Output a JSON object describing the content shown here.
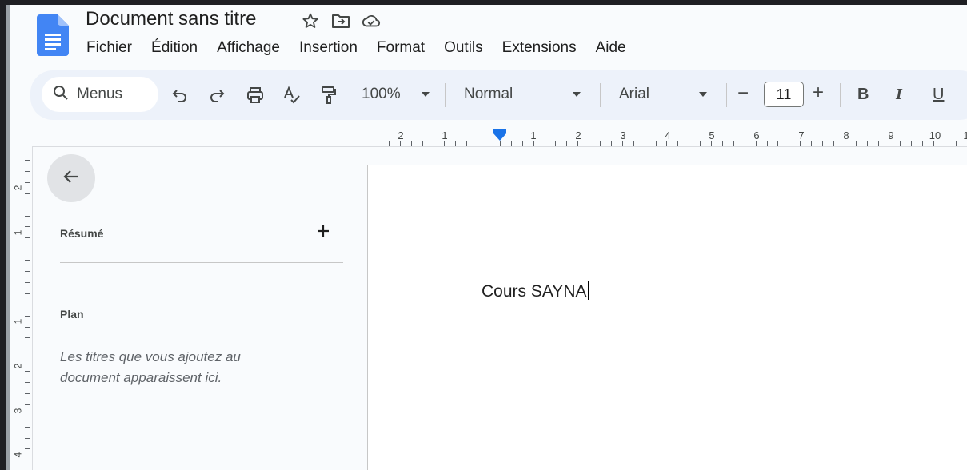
{
  "document": {
    "title": "Document sans titre"
  },
  "menu": [
    "Fichier",
    "Édition",
    "Affichage",
    "Insertion",
    "Format",
    "Outils",
    "Extensions",
    "Aide"
  ],
  "toolbar": {
    "search_label": "Menus",
    "zoom": "100%",
    "style": "Normal",
    "font": "Arial",
    "font_size": "11",
    "bold_label": "B",
    "italic_label": "I",
    "underline_label": "U",
    "decrease_label": "−",
    "increase_label": "+"
  },
  "ruler": {
    "h_numbers": [
      "2",
      "1",
      "1",
      "2",
      "3",
      "4",
      "5",
      "6",
      "7",
      "8",
      "9",
      "10",
      "1"
    ],
    "v_numbers": [
      "2",
      "1",
      "1",
      "2",
      "3",
      "4"
    ]
  },
  "outline": {
    "summary_label": "Résumé",
    "plan_label": "Plan",
    "hint": "Les titres que vous ajoutez au document apparaissent ici."
  },
  "page": {
    "text": "Cours SAYNA"
  },
  "colors": {
    "accent": "#1a73e8",
    "toolbar_bg": "#edf2fa",
    "app_bg": "#f9fbfd"
  }
}
